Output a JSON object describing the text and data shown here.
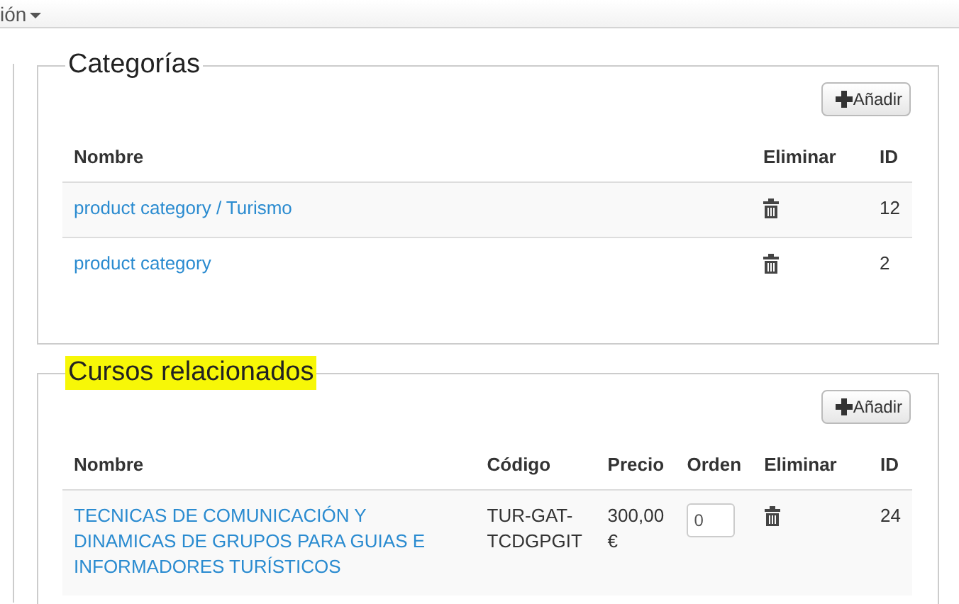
{
  "top_bar": {
    "menu_label": "ión"
  },
  "sections": [
    {
      "title": "Categorías",
      "highlighted": false,
      "add_button": "Añadir",
      "columns": [
        {
          "label": "Nombre",
          "kind": "link"
        },
        {
          "label": "Eliminar",
          "kind": "trash"
        },
        {
          "label": "ID",
          "kind": "text"
        }
      ],
      "rows": [
        {
          "cells": [
            "product category / Turismo",
            null,
            "12"
          ]
        },
        {
          "cells": [
            "product category",
            null,
            "2"
          ]
        }
      ]
    },
    {
      "title": "Cursos relacionados",
      "highlighted": true,
      "add_button": "Añadir",
      "columns": [
        {
          "label": "Nombre",
          "kind": "link"
        },
        {
          "label": "Código",
          "kind": "text"
        },
        {
          "label": "Precio",
          "kind": "text"
        },
        {
          "label": "Orden",
          "kind": "input"
        },
        {
          "label": "Eliminar",
          "kind": "trash"
        },
        {
          "label": "ID",
          "kind": "text"
        }
      ],
      "rows": [
        {
          "cells": [
            "TECNICAS DE COMUNICACIÓN Y DINAMICAS DE GRUPOS PARA GUIAS E INFORMADORES TURÍSTICOS",
            "TUR-GAT-TCDGPGIT",
            "300,00 €",
            "0",
            null,
            "24"
          ]
        }
      ]
    }
  ]
}
